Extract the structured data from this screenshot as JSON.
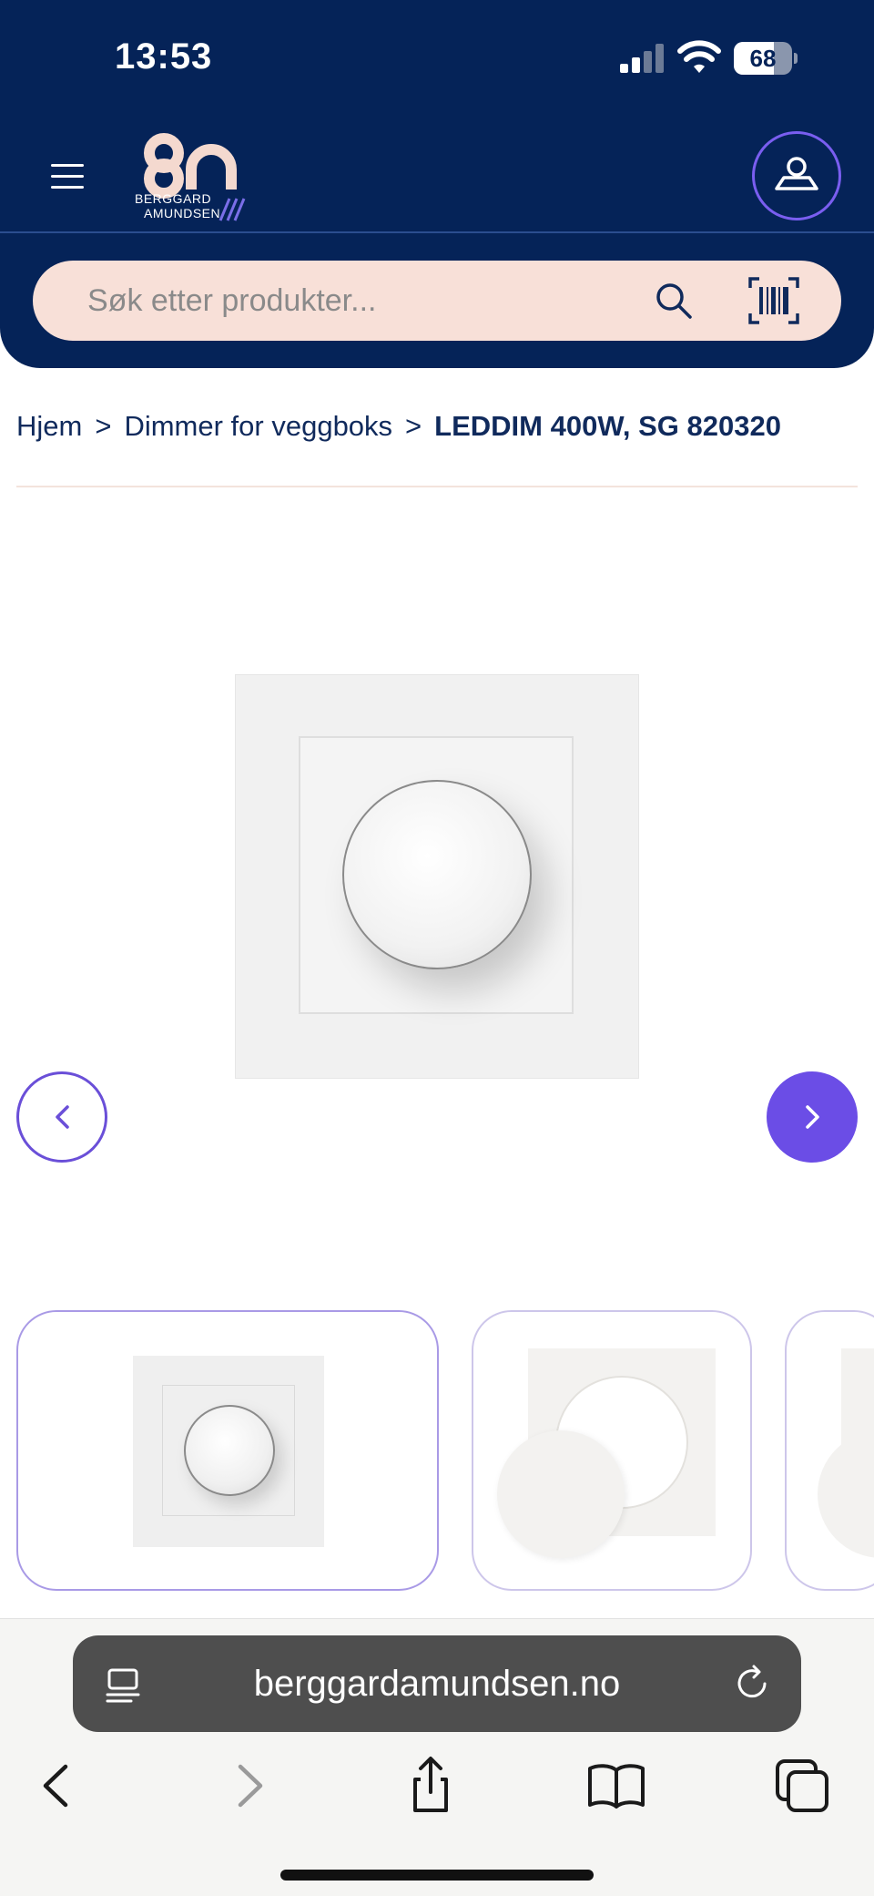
{
  "status_bar": {
    "time": "13:53",
    "battery": "68",
    "battery_level": 0.68
  },
  "header": {
    "logo_mark": "8n",
    "logo_line1": "BERGGARD",
    "logo_line2": "AMUNDSEN",
    "icons": {
      "menu": "hamburger-menu-icon",
      "user": "user-icon",
      "search": "search-icon",
      "barcode": "barcode-scanner-icon"
    }
  },
  "search": {
    "placeholder": "Søk etter produkter..."
  },
  "breadcrumb": {
    "items": [
      "Hjem",
      "Dimmer for veggboks"
    ],
    "separator": ">",
    "current": "LEDDIM 400W, SG 820320"
  },
  "gallery": {
    "thumbnails": 3,
    "selected_index": 0,
    "accent_color": "#6b4de6"
  },
  "browser": {
    "url": "berggardamundsen.no",
    "icons": {
      "tabs": "page-menu-icon",
      "reload": "reload-icon",
      "back": "back-arrow-icon",
      "forward": "forward-arrow-icon",
      "share": "share-icon",
      "bookmarks": "bookmarks-icon",
      "tabs_overview": "tabs-icon"
    }
  },
  "colors": {
    "header_bg": "#052358",
    "search_bg": "#f8e0d8",
    "accent": "#6b4de6",
    "text": "#102a5c"
  }
}
